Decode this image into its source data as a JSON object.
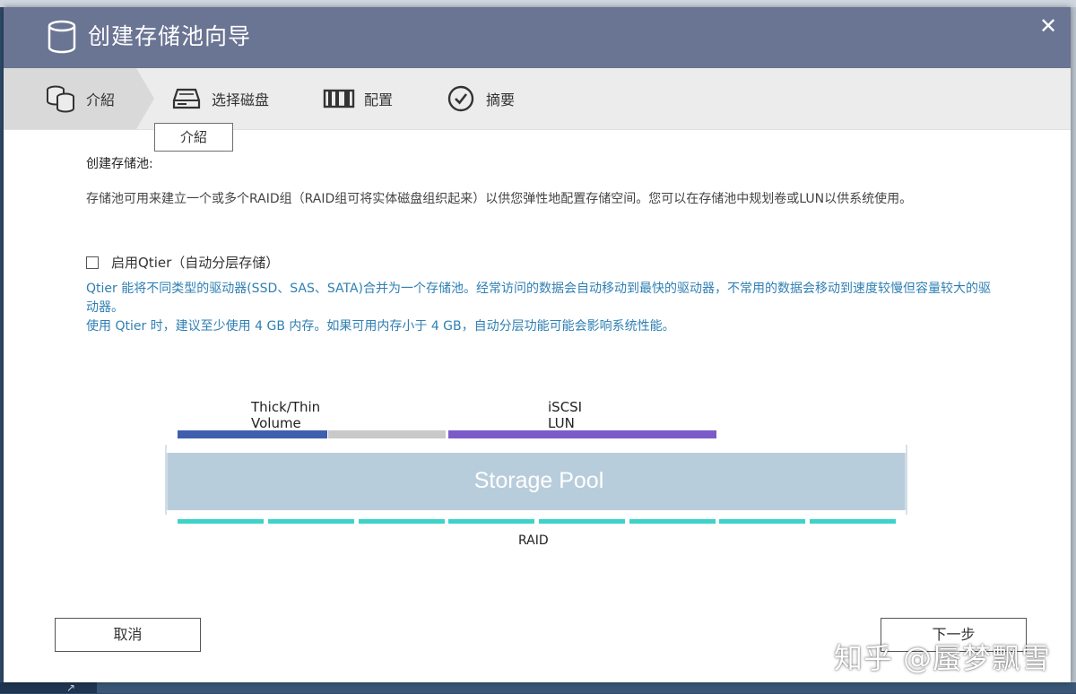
{
  "dialog": {
    "title": "创建存储池向导",
    "close_icon": "close-icon",
    "title_icon": "database-icon"
  },
  "steps": [
    {
      "label": "介紹",
      "icon": "database-stack-icon",
      "active": true
    },
    {
      "label": "选择磁盘",
      "icon": "hard-drive-icon",
      "active": false
    },
    {
      "label": "配置",
      "icon": "raid-config-icon",
      "active": false
    },
    {
      "label": "摘要",
      "icon": "check-circle-icon",
      "active": false
    }
  ],
  "tooltip": "介紹",
  "section_title": "创建存储池:",
  "description": "存储池可用来建立一个或多个RAID组（RAID组可将实体磁盘组织起来）以供您弹性地配置存储空间。您可以在存储池中规划卷或LUN以供系统使用。",
  "qtier": {
    "checkbox_label": "启用Qtier（自动分层存储）",
    "checked": false,
    "info_line1": "Qtier 能将不同类型的驱动器(SSD、SAS、SATA)合并为一个存储池。经常访问的数据会自动移动到最快的驱动器，不常用的数据会移动到速度较慢但容量较大的驱动器。",
    "info_line2": "使用 Qtier 时，建议至少使用 4 GB 内存。如果可用内存小于 4 GB，自动分层功能可能会影响系统性能。"
  },
  "diagram": {
    "volume_label": "Thick/Thin Volume",
    "lun_label": "iSCSI LUN",
    "pool_label": "Storage Pool",
    "raid_label": "RAID",
    "colors": {
      "volume_used": "#3f5eae",
      "volume_free": "#c9c9c9",
      "lun": "#7b5bc8",
      "pool": "#b8cddb",
      "raid": "#3cd3c8"
    }
  },
  "buttons": {
    "cancel": "取消",
    "next": "下一步"
  },
  "watermark": "知乎 @蜃梦飘雪"
}
